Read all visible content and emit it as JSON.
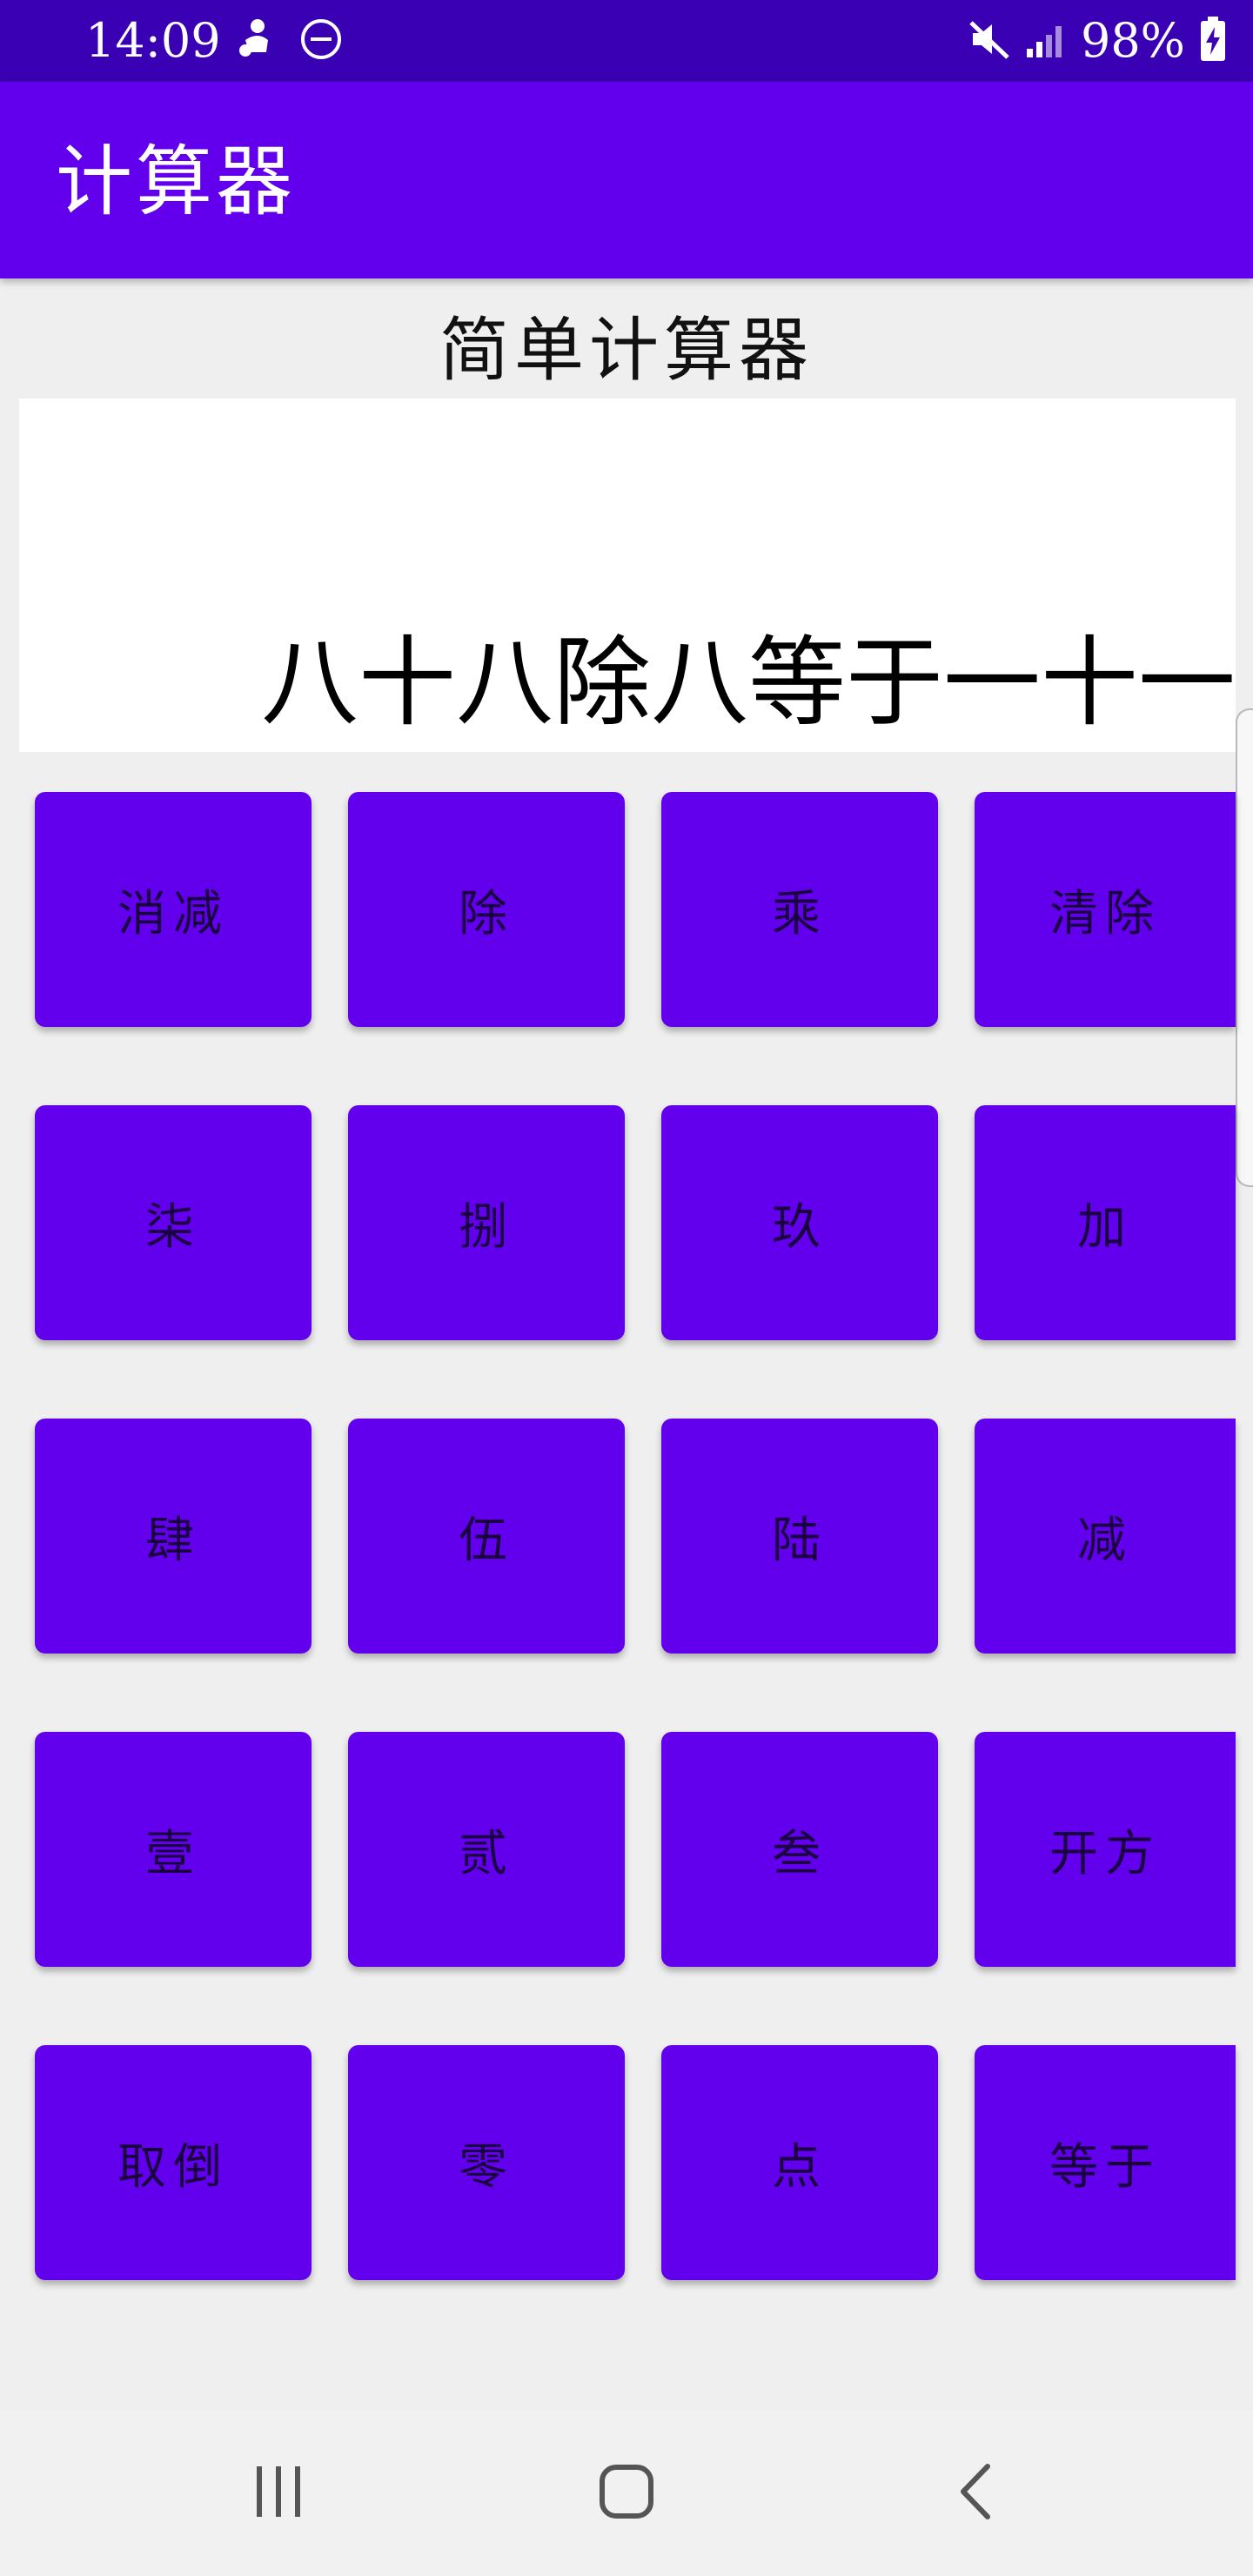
{
  "status_bar": {
    "time": "14:09",
    "battery_percent": "98%",
    "background": "#3a00b3",
    "left_icons": [
      "person-notification-icon",
      "do-not-disturb-icon"
    ],
    "right_icons": [
      "mute-icon",
      "signal-icon",
      "battery-charging-icon"
    ]
  },
  "app_bar": {
    "title": "计算器",
    "background": "#6200ee"
  },
  "main": {
    "heading": "简单计算器",
    "display_text": "八十八除八等于一十一"
  },
  "keypad": {
    "key_color": "#6200ee",
    "rows": [
      [
        "消减",
        "除",
        "乘",
        "清除"
      ],
      [
        "柒",
        "捌",
        "玖",
        "加"
      ],
      [
        "肆",
        "伍",
        "陆",
        "减"
      ],
      [
        "壹",
        "贰",
        "叁",
        "开方"
      ],
      [
        "取倒",
        "零",
        "点",
        "等于"
      ]
    ]
  },
  "nav_bar": {
    "buttons": [
      "recent-apps-icon",
      "home-icon",
      "back-icon"
    ]
  }
}
